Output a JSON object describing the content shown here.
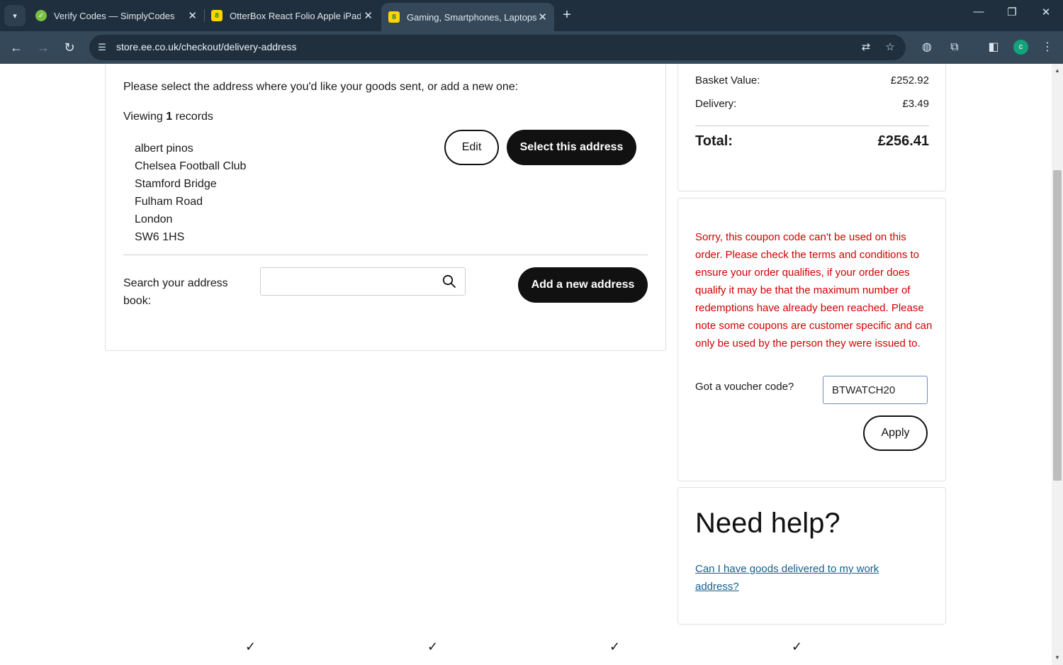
{
  "browser": {
    "tabs": [
      {
        "title": "Verify Codes — SimplyCodes",
        "favicon": "simplycodes-icon",
        "color": "#7bc043",
        "active": false
      },
      {
        "title": "OtterBox React Folio Apple iPad",
        "favicon": "ee-icon",
        "color": "#ffd400",
        "active": false
      },
      {
        "title": "Gaming, Smartphones, Laptops",
        "favicon": "ee-icon",
        "color": "#ffd400",
        "active": true
      }
    ],
    "url": "store.ee.co.uk/checkout/delivery-address",
    "profile_initial": "c"
  },
  "address": {
    "intro": "Please select the address where you'd like your goods sent, or add a new one:",
    "viewing_prefix": "Viewing",
    "viewing_count": "1",
    "viewing_suffix": "records",
    "lines": [
      "albert pinos",
      "Chelsea Football Club",
      "Stamford Bridge",
      "Fulham Road",
      "London",
      "SW6 1HS"
    ],
    "edit_label": "Edit",
    "select_label": "Select this address",
    "search_label": "Search your address book:",
    "search_value": "",
    "add_label": "Add a new address"
  },
  "summary": {
    "basket_label": "Basket Value:",
    "basket_value": "£252.92",
    "delivery_label": "Delivery:",
    "delivery_value": "£3.49",
    "total_label": "Total:",
    "total_value": "£256.41"
  },
  "voucher": {
    "error": "Sorry, this coupon code can't be used on this order. Please check the terms and conditions to ensure your order qualifies, if your order does qualify it may be that the maximum number of redemptions have already been reached. Please note some coupons are customer specific and can only be used by the person they were issued to.",
    "label": "Got a voucher code?",
    "code": "BTWATCH20",
    "apply_label": "Apply",
    "error_color": "#d00000"
  },
  "help": {
    "title": "Need help?",
    "link": "Can I have goods delivered to my work address?"
  },
  "steps": {
    "icon": "check-icon",
    "count": 4
  }
}
